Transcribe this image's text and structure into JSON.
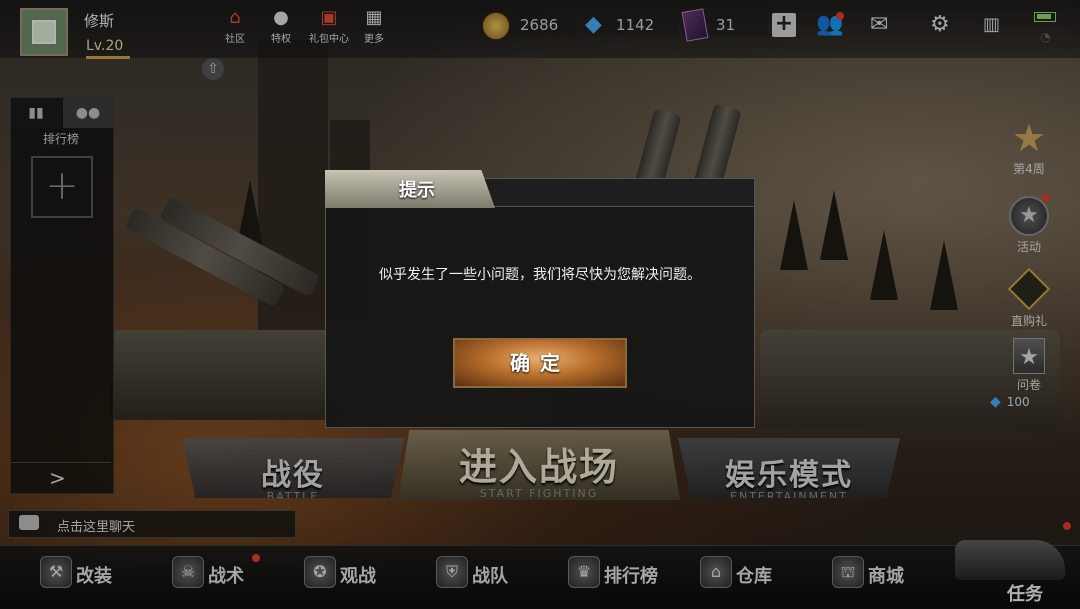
{
  "player": {
    "name": "修斯",
    "level": "Lv.20"
  },
  "top_nav": [
    {
      "label": "社区",
      "icon": "home-icon"
    },
    {
      "label": "特权",
      "icon": "penguin-icon"
    },
    {
      "label": "礼包中心",
      "icon": "gift-icon"
    },
    {
      "label": "更多",
      "icon": "grid-icon"
    }
  ],
  "currencies": {
    "gold": "2686",
    "diamonds": "1142",
    "tickets": "31"
  },
  "left_panel": {
    "tab_icons": [
      "bar-chart-icon",
      "friends-icon"
    ],
    "title": "排行榜",
    "add_symbol": "+",
    "expand_symbol": ">"
  },
  "chat": {
    "placeholder": "点击这里聊天"
  },
  "right_side": [
    {
      "label": "第4周",
      "icon": "star-icon"
    },
    {
      "label": "活动",
      "icon": "activity-star-icon"
    },
    {
      "label": "直购礼",
      "icon": "diamond-badge-icon"
    },
    {
      "label": "问卷",
      "icon": "survey-star-icon"
    }
  ],
  "reward": {
    "diamonds": "100"
  },
  "modes": {
    "campaign": {
      "label": "战役",
      "sub": "BATTLE"
    },
    "enter": {
      "label": "进入战场",
      "sub": "START FIGHTING"
    },
    "entertainment": {
      "label": "娱乐模式",
      "sub": "ENTERTAINMENT"
    }
  },
  "bottom_nav": [
    {
      "label": "改装",
      "icon": "wrench-icon",
      "badge": false
    },
    {
      "label": "战术",
      "icon": "gasmask-icon",
      "badge": true
    },
    {
      "label": "观战",
      "icon": "star-eye-icon",
      "badge": false
    },
    {
      "label": "战队",
      "icon": "shield-icon",
      "badge": false
    },
    {
      "label": "排行榜",
      "icon": "trophy-icon",
      "badge": false
    },
    {
      "label": "仓库",
      "icon": "warehouse-icon",
      "badge": false
    },
    {
      "label": "商城",
      "icon": "shop-icon",
      "badge": false
    }
  ],
  "task": {
    "label": "任务"
  },
  "dialog": {
    "title": "提示",
    "message": "似乎发生了一些小问题，我们将尽快为您解决问题。",
    "confirm": "确定"
  }
}
